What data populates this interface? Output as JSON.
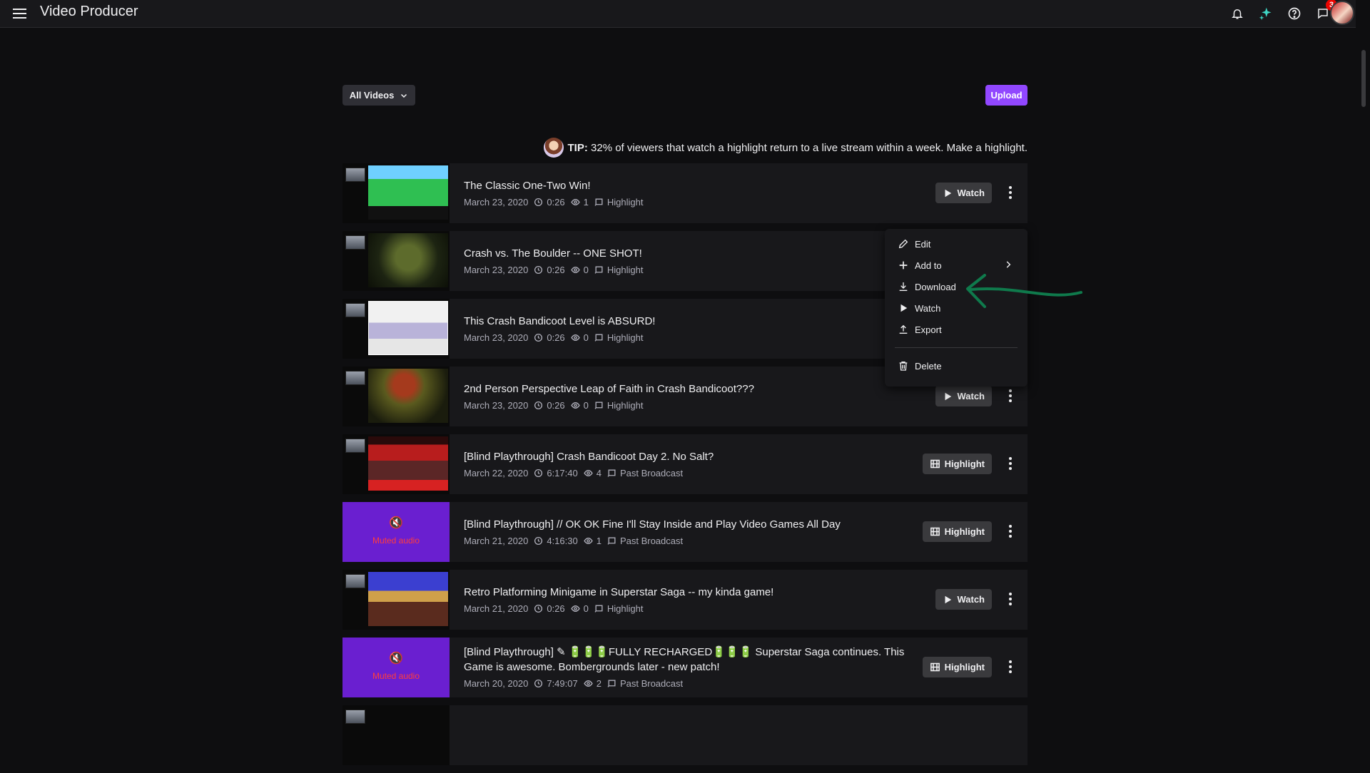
{
  "app": {
    "title": "Video Producer"
  },
  "header": {
    "notification_count": "3"
  },
  "toolbar": {
    "filter_label": "All Videos",
    "upload_label": "Upload"
  },
  "tip": {
    "prefix": "TIP:",
    "text": "32% of viewers that watch a highlight return to a live stream within a week. Make a highlight."
  },
  "videos": [
    {
      "title": "The Classic One-Two Win!",
      "date": "March 23, 2020",
      "duration": "0:26",
      "views": "1",
      "type": "Highlight",
      "action": "Watch"
    },
    {
      "title": "Crash vs. The Boulder -- ONE SHOT!",
      "date": "March 23, 2020",
      "duration": "0:26",
      "views": "0",
      "type": "Highlight",
      "action": ""
    },
    {
      "title": "This Crash Bandicoot Level is ABSURD!",
      "date": "March 23, 2020",
      "duration": "0:26",
      "views": "0",
      "type": "Highlight",
      "action": ""
    },
    {
      "title": "2nd Person Perspective Leap of Faith in Crash Bandicoot???",
      "date": "March 23, 2020",
      "duration": "0:26",
      "views": "0",
      "type": "Highlight",
      "action": "Watch"
    },
    {
      "title": "[Blind Playthrough] Crash Bandicoot Day 2. No Salt?",
      "date": "March 22, 2020",
      "duration": "6:17:40",
      "views": "4",
      "type": "Past Broadcast",
      "action": "Highlight"
    },
    {
      "title": "[Blind Playthrough] // OK OK Fine I'll Stay Inside and Play Video Games All Day",
      "date": "March 21, 2020",
      "duration": "4:16:30",
      "views": "1",
      "type": "Past Broadcast",
      "action": "Highlight",
      "muted_label": "Muted audio"
    },
    {
      "title": "Retro Platforming Minigame in Superstar Saga -- my kinda game!",
      "date": "March 21, 2020",
      "duration": "0:26",
      "views": "0",
      "type": "Highlight",
      "action": "Watch"
    },
    {
      "title": "[Blind Playthrough] ✎ 🔋🔋🔋FULLY RECHARGED🔋🔋🔋 Superstar Saga continues. This Game is awesome. Bombergrounds later - new patch!",
      "date": "March 20, 2020",
      "duration": "7:49:07",
      "views": "2",
      "type": "Past Broadcast",
      "action": "Highlight",
      "muted_label": "Muted audio"
    }
  ],
  "context_menu": {
    "items": [
      "Edit",
      "Add to",
      "Download",
      "Watch",
      "Export"
    ],
    "delete_label": "Delete"
  },
  "colors": {
    "accent": "#9147ff",
    "annotation_arrow": "#0f7a4c"
  }
}
